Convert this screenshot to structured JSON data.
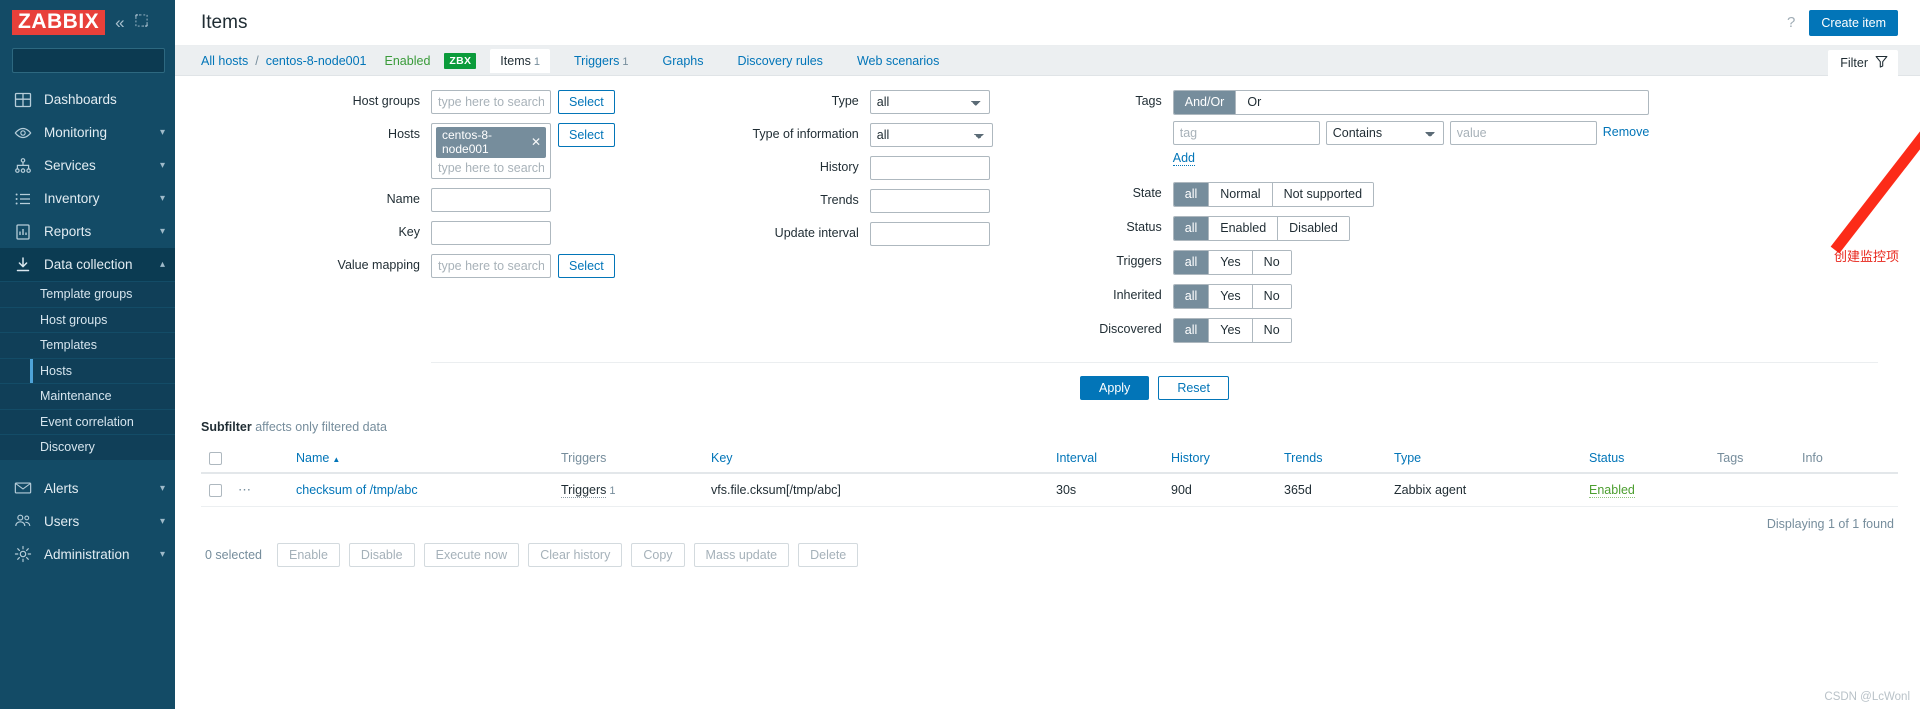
{
  "sidebar": {
    "logo_text": "ZABBIX",
    "collapse_icon": "chevron-double-left-icon",
    "expand_icon": "expand-icon",
    "search_placeholder": "",
    "search_value": "",
    "items": [
      {
        "label": "Dashboards",
        "icon": "dashboard-icon",
        "caret": false
      },
      {
        "label": "Monitoring",
        "icon": "eye-icon",
        "caret": true
      },
      {
        "label": "Services",
        "icon": "services-icon",
        "caret": true
      },
      {
        "label": "Inventory",
        "icon": "list-icon",
        "caret": true
      },
      {
        "label": "Reports",
        "icon": "report-icon",
        "caret": true
      },
      {
        "label": "Data collection",
        "icon": "download-icon",
        "caret": true,
        "active": true
      }
    ],
    "subitems": [
      {
        "label": "Template groups"
      },
      {
        "label": "Host groups"
      },
      {
        "label": "Templates"
      },
      {
        "label": "Hosts",
        "selected": true
      },
      {
        "label": "Maintenance"
      },
      {
        "label": "Event correlation"
      },
      {
        "label": "Discovery"
      }
    ],
    "items_bottom": [
      {
        "label": "Alerts",
        "icon": "envelope-icon",
        "caret": true
      },
      {
        "label": "Users",
        "icon": "users-icon",
        "caret": true
      },
      {
        "label": "Administration",
        "icon": "gear-icon",
        "caret": true
      }
    ]
  },
  "header": {
    "title": "Items",
    "help_label": "?",
    "create_button": "Create item"
  },
  "breadcrumb": {
    "all_hosts": "All hosts",
    "separator": "/",
    "host": "centos-8-node001",
    "status": "Enabled",
    "agent_badge": "ZBX",
    "tabs": [
      {
        "label": "Items",
        "count": "1",
        "active": true
      },
      {
        "label": "Triggers",
        "count": "1",
        "active": false
      },
      {
        "label": "Graphs",
        "count": "",
        "active": false
      },
      {
        "label": "Discovery rules",
        "count": "",
        "active": false
      },
      {
        "label": "Web scenarios",
        "count": "",
        "active": false
      }
    ],
    "filter_tab": "Filter",
    "filter_icon": "funnel-icon"
  },
  "filter": {
    "host_groups": {
      "label": "Host groups",
      "placeholder": "type here to search",
      "value": "",
      "select_button": "Select"
    },
    "hosts": {
      "label": "Hosts",
      "chip": "centos-8-node001",
      "chip_remove_icon": "close-icon",
      "placeholder": "type here to search",
      "select_button": "Select"
    },
    "name": {
      "label": "Name",
      "value": ""
    },
    "key": {
      "label": "Key",
      "value": ""
    },
    "value_mapping": {
      "label": "Value mapping",
      "placeholder": "type here to search",
      "value": "",
      "select_button": "Select"
    },
    "type": {
      "label": "Type",
      "value": "all"
    },
    "type_of_information": {
      "label": "Type of information",
      "value": "all"
    },
    "history": {
      "label": "History",
      "value": ""
    },
    "trends": {
      "label": "Trends",
      "value": ""
    },
    "update_interval": {
      "label": "Update interval",
      "value": ""
    },
    "tags": {
      "label": "Tags",
      "operators": [
        "And/Or",
        "Or"
      ],
      "selected_operator": "And/Or",
      "tag_placeholder": "tag",
      "tag_value": "",
      "condition": "Contains",
      "value_placeholder": "value",
      "value_value": "",
      "remove_label": "Remove",
      "add_label": "Add"
    },
    "state": {
      "label": "State",
      "options": [
        "all",
        "Normal",
        "Not supported"
      ],
      "selected": "all"
    },
    "status": {
      "label": "Status",
      "options": [
        "all",
        "Enabled",
        "Disabled"
      ],
      "selected": "all"
    },
    "triggers": {
      "label": "Triggers",
      "options": [
        "all",
        "Yes",
        "No"
      ],
      "selected": "all"
    },
    "inherited": {
      "label": "Inherited",
      "options": [
        "all",
        "Yes",
        "No"
      ],
      "selected": "all"
    },
    "discovered": {
      "label": "Discovered",
      "options": [
        "all",
        "Yes",
        "No"
      ],
      "selected": "all"
    },
    "apply_button": "Apply",
    "reset_button": "Reset"
  },
  "subfilter": {
    "title": "Subfilter",
    "note": "affects only filtered data"
  },
  "table": {
    "columns": [
      "Name",
      "Triggers",
      "Key",
      "Interval",
      "History",
      "Trends",
      "Type",
      "Status",
      "Tags",
      "Info"
    ],
    "sort_column": "Name",
    "sort_dir": "▲",
    "rows": [
      {
        "menu_icon": "ellipsis-icon",
        "name": "checksum of /tmp/abc",
        "triggers_label": "Triggers",
        "triggers_count": "1",
        "key": "vfs.file.cksum[/tmp/abc]",
        "interval": "30s",
        "history": "90d",
        "trends": "365d",
        "type": "Zabbix agent",
        "status": "Enabled",
        "tags": "",
        "info": ""
      }
    ],
    "displaying": "Displaying 1 of 1 found"
  },
  "footer": {
    "selected_text": "0 selected",
    "buttons": [
      "Enable",
      "Disable",
      "Execute now",
      "Clear history",
      "Copy",
      "Mass update",
      "Delete"
    ]
  },
  "annotation": {
    "text": "创建监控项",
    "color": "#e8261c"
  },
  "watermark": "CSDN @LcWonl"
}
